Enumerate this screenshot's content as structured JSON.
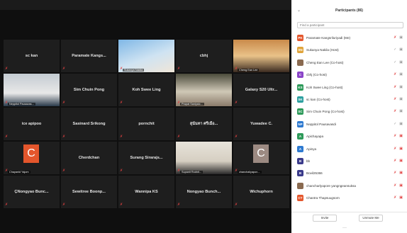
{
  "panel": {
    "title": "Participants (86)",
    "search_placeholder": "Find a participant",
    "invite_label": "Invite",
    "unmute_label": "Unmute Me",
    "more_label": "···"
  },
  "participants": [
    {
      "name": "Paramate Kangsriluriyadi (Me)",
      "initials": "PK",
      "color": "#e4562c",
      "muted": true,
      "video": true
    },
    {
      "name": "Sukanya Nakila (Host)",
      "initials": "SN",
      "color": "#e0a43a",
      "muted": false,
      "video": true
    },
    {
      "name": "Cheng Ean Lee (Co-host)",
      "initials": "",
      "color": "#8a6a50",
      "muted": false,
      "video": true
    },
    {
      "name": "cbhj (Co-host)",
      "initials": "C",
      "color": "#8a44c8",
      "muted": true,
      "video": true
    },
    {
      "name": "Koh Swee Ling (Co-host)",
      "initials": "KS",
      "color": "#2e9a5a",
      "muted": true,
      "video": true
    },
    {
      "name": "sc kan (Co-host)",
      "initials": "SK",
      "color": "#2ea0a0",
      "muted": true,
      "video": true
    },
    {
      "name": "Sim Chuin Pong (Co-host)",
      "initials": "SC",
      "color": "#2e9a5a",
      "muted": true,
      "video": true
    },
    {
      "name": "Neppitol Pausavasdi",
      "initials": "NP",
      "color": "#2e7ad0",
      "muted": false,
      "video": true
    },
    {
      "name": "Apichayapa",
      "initials": "A",
      "color": "#2e9a5a",
      "muted": true,
      "video": false
    },
    {
      "name": "Apinya",
      "initials": "A",
      "color": "#2e7ad0",
      "muted": true,
      "video": false
    },
    {
      "name": "bb",
      "initials": "B",
      "color": "#3a3a8a",
      "muted": true,
      "video": false
    },
    {
      "name": "Bovil25366",
      "initials": "B",
      "color": "#3a3a8a",
      "muted": true,
      "video": false
    },
    {
      "name": "chancharlyapore yangngeansuksa",
      "initials": "",
      "color": "#8a6a50",
      "muted": true,
      "video": false
    },
    {
      "name": "Chantra Thapsuugsorn",
      "initials": "CT",
      "color": "#e4562c",
      "muted": true,
      "video": false
    }
  ],
  "tiles": [
    {
      "name": "sc kan",
      "caption": ""
    },
    {
      "name": "Paramate Kangs...",
      "caption": ""
    },
    {
      "name": "",
      "caption": "Sukanya Nakila"
    },
    {
      "name": "cbhj",
      "caption": ""
    },
    {
      "name": "",
      "caption": "Cheng Ean Lee"
    },
    {
      "name": "",
      "caption": "Neppitol Pausavas..."
    },
    {
      "name": "Sim Chuin Pong",
      "caption": ""
    },
    {
      "name": "Koh Swee Ling",
      "caption": ""
    },
    {
      "name": "",
      "caption": "Prapat Saniyaic..."
    },
    {
      "name": "Galaxy S20 Ultr...",
      "caption": ""
    },
    {
      "name": "ice apipoo",
      "caption": ""
    },
    {
      "name": "Sasinard Srikong",
      "caption": ""
    },
    {
      "name": "pornchit",
      "caption": ""
    },
    {
      "name": "สุนันทา ศรีเมือ...",
      "caption": ""
    },
    {
      "name": "Yuwadee C.",
      "caption": ""
    },
    {
      "name": "",
      "caption": "Chayanid Yajom",
      "avatar": "C"
    },
    {
      "name": "Cherdchan",
      "caption": ""
    },
    {
      "name": "Surang Sirarajs...",
      "caption": ""
    },
    {
      "name": "",
      "caption": "Supanit Rodnit..."
    },
    {
      "name": "",
      "caption": "chanchaliyapon...",
      "avatar": "C"
    },
    {
      "name": "ÇNongyao Bunc...",
      "caption": ""
    },
    {
      "name": "Sewitree Boonp...",
      "caption": ""
    },
    {
      "name": "Wannipa KS",
      "caption": ""
    },
    {
      "name": "Nongyao Bunch...",
      "caption": ""
    },
    {
      "name": "Wichuphorn",
      "caption": ""
    }
  ]
}
